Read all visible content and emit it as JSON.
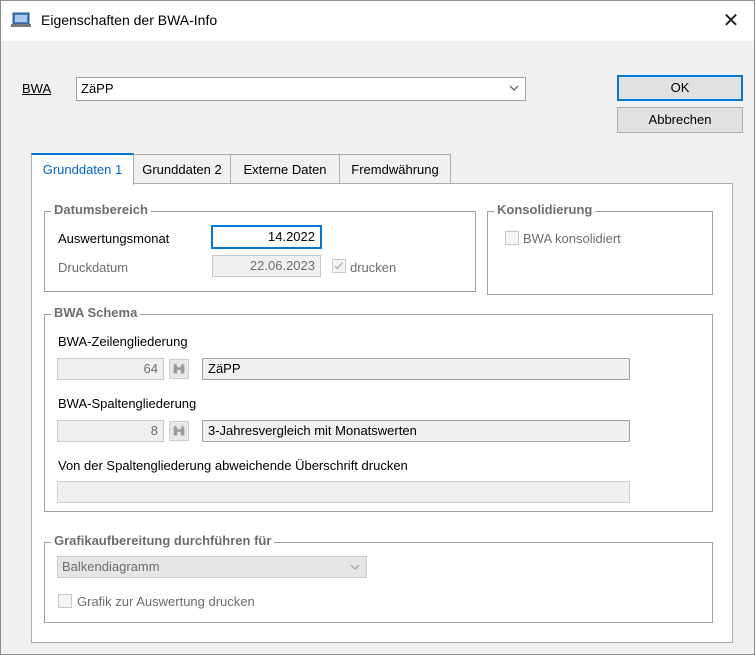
{
  "window": {
    "title": "Eigenschaften der BWA-Info",
    "close_glyph": "✕"
  },
  "bwa": {
    "label": "BWA",
    "value": "ZäPP"
  },
  "buttons": {
    "ok": "OK",
    "cancel": "Abbrechen"
  },
  "tabs": [
    {
      "label": "Grunddaten 1",
      "active": true
    },
    {
      "label": "Grunddaten 2",
      "active": false
    },
    {
      "label": "Externe Daten",
      "active": false
    },
    {
      "label": "Fremdwährung",
      "active": false
    }
  ],
  "datumsbereich": {
    "title": "Datumsbereich",
    "auswertungsmonat_label": "Auswertungsmonat",
    "auswertungsmonat_value": "14.2022",
    "druckdatum_label": "Druckdatum",
    "druckdatum_value": "22.06.2023",
    "drucken_label": "drucken",
    "drucken_checked": true
  },
  "konsolidierung": {
    "title": "Konsolidierung",
    "checkbox_label": "BWA konsolidiert",
    "checked": false
  },
  "schema": {
    "title": "BWA Schema",
    "zeilen_label": "BWA-Zeilengliederung",
    "zeilen_number": "64",
    "zeilen_name": "ZäPP",
    "spalten_label": "BWA-Spaltengliederung",
    "spalten_number": "8",
    "spalten_name": "3-Jahresvergleich mit Monatswerten",
    "ueberschrift_label": "Von der Spaltengliederung abweichende Überschrift drucken",
    "ueberschrift_value": ""
  },
  "grafik": {
    "title": "Grafikaufbereitung durchführen für",
    "diagram_type": "Balkendiagramm",
    "checkbox_label": "Grafik zur Auswertung drucken",
    "checked": false
  },
  "icons": {
    "title": "window-app-icon",
    "lookup": "binoculars-icon",
    "dropdown": "chevron-down-icon",
    "check": "checkmark-icon"
  }
}
